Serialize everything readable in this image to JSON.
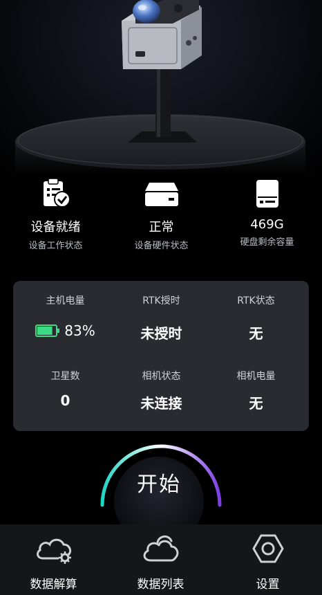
{
  "status": {
    "device_ready": {
      "value": "设备就绪",
      "label": "设备工作状态",
      "icon": "clipboard-check-icon"
    },
    "hardware": {
      "value": "正常",
      "label": "设备硬件状态",
      "icon": "hardware-box-icon"
    },
    "disk": {
      "value": "469G",
      "label": "硬盘剩余容量",
      "icon": "hard-disk-icon"
    }
  },
  "panel": {
    "host_battery": {
      "label": "主机电量",
      "value": "83%",
      "level_percent": 83
    },
    "rtk_auth": {
      "label": "RTK授时",
      "value": "未授时"
    },
    "rtk_status": {
      "label": "RTK状态",
      "value": "无"
    },
    "satellites": {
      "label": "卫星数",
      "value": "0"
    },
    "camera_status": {
      "label": "相机状态",
      "value": "未连接"
    },
    "camera_battery": {
      "label": "相机电量",
      "value": "无"
    }
  },
  "start_button": {
    "label": "开始"
  },
  "tabs": [
    {
      "label": "数据解算",
      "icon": "cloud-gear-icon"
    },
    {
      "label": "数据列表",
      "icon": "clouds-icon"
    },
    {
      "label": "设置",
      "icon": "hex-nut-settings-icon"
    }
  ],
  "colors": {
    "battery": "#3ddc84",
    "arc_start": "#1fd6c4",
    "arc_end": "#7b3fe4",
    "panel_bg": "#2a2b30",
    "tabbar_bg": "#15161a"
  }
}
